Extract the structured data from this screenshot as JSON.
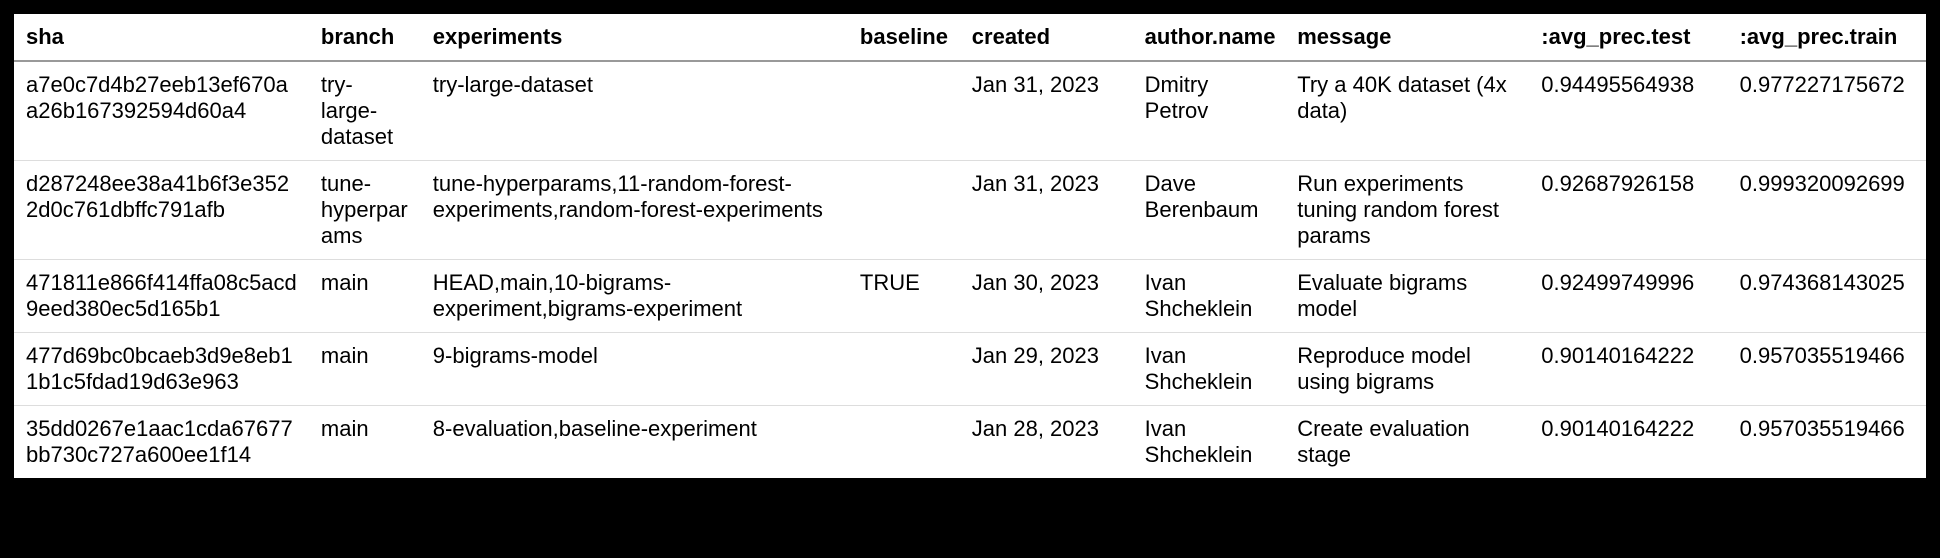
{
  "table": {
    "headers": {
      "sha": "sha",
      "branch": "branch",
      "experiments": "experiments",
      "baseline": "baseline",
      "created": "created",
      "author_name": "author.name",
      "message": "message",
      "avg_prec_test": ":avg_prec.test",
      "avg_prec_train": ":avg_prec.train"
    },
    "rows": [
      {
        "sha": "a7e0c7d4b27eeb13ef670aa26b167392594d60a4",
        "branch": "try-large-dataset",
        "experiments": "try-large-dataset",
        "baseline": "",
        "created": "Jan 31, 2023",
        "author_name": "Dmitry Petrov",
        "message": "Try a 40K dataset (4x data)",
        "avg_prec_test": "0.94495564938",
        "avg_prec_train": "0.977227175672"
      },
      {
        "sha": "d287248ee38a41b6f3e3522d0c761dbffc791afb",
        "branch": "tune-hyperparams",
        "experiments": "tune-hyperparams,11-random-forest-experiments,random-forest-experiments",
        "baseline": "",
        "created": "Jan 31, 2023",
        "author_name": "Dave Berenbaum",
        "message": "Run experiments tuning random forest params",
        "avg_prec_test": "0.92687926158",
        "avg_prec_train": "0.999320092699"
      },
      {
        "sha": "471811e866f414ffa08c5acd9eed380ec5d165b1",
        "branch": "main",
        "experiments": "HEAD,main,10-bigrams-experiment,bigrams-experiment",
        "baseline": "TRUE",
        "created": "Jan 30, 2023",
        "author_name": "Ivan Shcheklein",
        "message": "Evaluate bigrams model",
        "avg_prec_test": "0.92499749996",
        "avg_prec_train": "0.974368143025"
      },
      {
        "sha": "477d69bc0bcaeb3d9e8eb11b1c5fdad19d63e963",
        "branch": "main",
        "experiments": "9-bigrams-model",
        "baseline": "",
        "created": "Jan 29, 2023",
        "author_name": "Ivan Shcheklein",
        "message": "Reproduce model using bigrams",
        "avg_prec_test": "0.90140164222",
        "avg_prec_train": "0.957035519466"
      },
      {
        "sha": "35dd0267e1aac1cda67677bb730c727a600ee1f14",
        "branch": "main",
        "experiments": "8-evaluation,baseline-experiment",
        "baseline": "",
        "created": "Jan 28, 2023",
        "author_name": "Ivan Shcheklein",
        "message": "Create evaluation stage",
        "avg_prec_test": "0.90140164222",
        "avg_prec_train": "0.957035519466"
      }
    ]
  }
}
